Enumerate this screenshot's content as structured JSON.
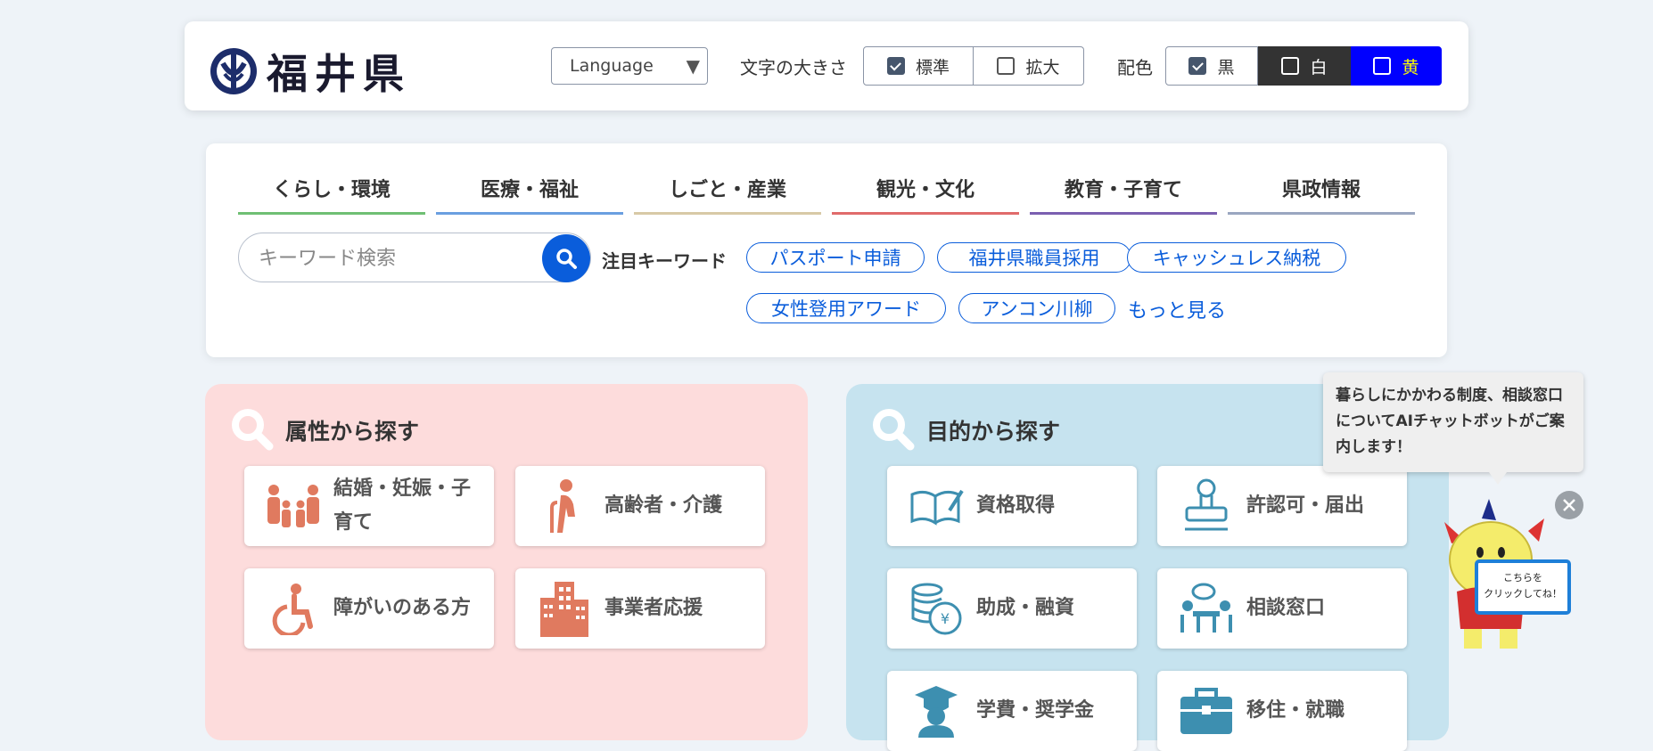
{
  "header": {
    "logo_text": "福井県",
    "language": "Language",
    "font_size_label": "文字の大きさ",
    "font_size_options": [
      {
        "label": "標準",
        "checked": true
      },
      {
        "label": "拡大",
        "checked": false
      }
    ],
    "color_label": "配色",
    "color_options": [
      {
        "label": "黒",
        "checked": true
      },
      {
        "label": "白",
        "checked": false
      },
      {
        "label": "黄",
        "checked": false
      }
    ]
  },
  "nav": {
    "tabs": [
      {
        "label": "くらし・環境",
        "color": "#6fbf73"
      },
      {
        "label": "医療・福祉",
        "color": "#6a9fe0"
      },
      {
        "label": "しごと・産業",
        "color": "#d8c9a6"
      },
      {
        "label": "観光・文化",
        "color": "#e06b6b"
      },
      {
        "label": "教育・子育て",
        "color": "#7a5fb0"
      },
      {
        "label": "県政情報",
        "color": "#9aa6c0"
      }
    ]
  },
  "search": {
    "placeholder": "キーワード検索",
    "keywords_label": "注目キーワード",
    "keywords": [
      "パスポート申請",
      "福井県職員採用",
      "キャッシュレス納税",
      "女性登用アワード",
      "アンコン川柳"
    ],
    "more": "もっと見る"
  },
  "attribute_panel": {
    "title": "属性から探す",
    "cards": [
      {
        "label": "結婚・妊娠・子育て",
        "icon": "family-icon"
      },
      {
        "label": "高齢者・介護",
        "icon": "elderly-icon"
      },
      {
        "label": "障がいのある方",
        "icon": "wheelchair-icon"
      },
      {
        "label": "事業者応援",
        "icon": "building-icon"
      }
    ]
  },
  "purpose_panel": {
    "title": "目的から探す",
    "cards": [
      {
        "label": "資格取得",
        "icon": "book-icon"
      },
      {
        "label": "許認可・届出",
        "icon": "stamp-icon"
      },
      {
        "label": "助成・融資",
        "icon": "coins-icon"
      },
      {
        "label": "相談窓口",
        "icon": "consultation-icon"
      },
      {
        "label": "学費・奨学金",
        "icon": "graduate-icon"
      },
      {
        "label": "移住・就職",
        "icon": "briefcase-icon"
      }
    ]
  },
  "chatbot": {
    "message": "暮らしにかかわる制度、相談窓口についてAIチャットボットがご案内します！",
    "sign_text": "こちらをクリックしてね！"
  },
  "colors": {
    "accent_blue": "#0a5ddb",
    "attribute_bg": "#fddcdc",
    "purpose_bg": "#c6e3ef",
    "attribute_icon": "#e07a5f",
    "purpose_icon": "#3d8fb0"
  }
}
